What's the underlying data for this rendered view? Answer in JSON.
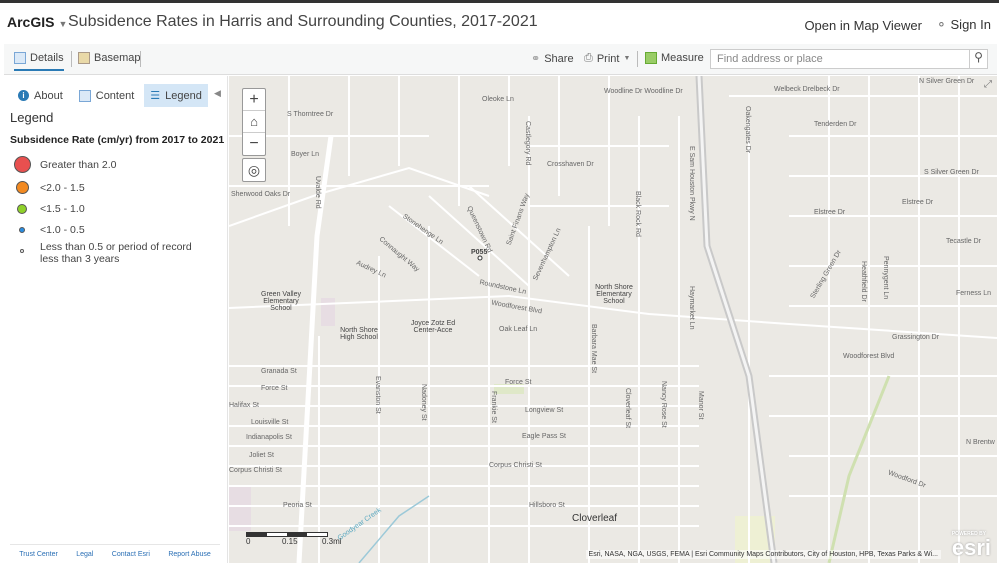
{
  "header": {
    "brand": "ArcGIS",
    "title": "Subsidence Rates in Harris and Surrounding Counties, 2017-2021",
    "open_map_viewer": "Open in Map Viewer",
    "sign_in": "Sign In"
  },
  "toolbar": {
    "details": "Details",
    "basemap": "Basemap",
    "share": "Share",
    "print": "Print",
    "measure": "Measure",
    "search_placeholder": "Find address or place"
  },
  "sidebar": {
    "tabs": [
      "About",
      "Content",
      "Legend"
    ],
    "legend_heading": "Legend",
    "legend_title": "Subsidence Rate (cm/yr) from 2017 to 2021",
    "items": [
      {
        "label": "Greater than 2.0",
        "color": "#e8504f"
      },
      {
        "label": "<2.0 - 1.5",
        "color": "#f28a22"
      },
      {
        "label": "<1.5 - 1.0",
        "color": "#8fd12a"
      },
      {
        "label": "<1.0 - 0.5",
        "color": "#2a8de0"
      },
      {
        "label": "Less than 0.5 or period of record less than 3 years",
        "color": "#ffffff"
      }
    ],
    "footer": [
      "Trust Center",
      "Legal",
      "Contact Esri",
      "Report Abuse"
    ]
  },
  "map": {
    "labels": [
      "S Thorntree Dr",
      "Oleoke Ln",
      "Woodline Dr Woodline Dr",
      "Welbeck Drelbeck Dr",
      "N Silver Green Dr",
      "Boyer Ln",
      "Crosshaven Dr",
      "Oakengates Dr",
      "Tenderden Dr",
      "S Silver Green Dr",
      "Sherwood Oaks Dr",
      "Elstree Dr",
      "Elstree Dr",
      "Tecastle Dr",
      "P055",
      "Stonehenge Ln",
      "Connaught Way",
      "Audrey Ln",
      "Roundstone Ln",
      "North Shore Elementary School",
      "Ferness Ln",
      "Green Valley Elementary School",
      "Woodforest Blvd",
      "North Shore High School",
      "Joyce Zotz Ed Center-Acce",
      "Oak Leaf Ln",
      "Grassington Dr",
      "Woodforest Blvd",
      "Granada St",
      "Force St",
      "Force St",
      "Halifax St",
      "Longview St",
      "Louisville St",
      "Indianapolis St",
      "Eagle Pass St",
      "Joliet St",
      "N Brentw",
      "Corpus Christi St",
      "Corpus Christi St",
      "Peoria St",
      "Hillsboro St",
      "Cloverleaf",
      "Woodford Dr",
      "Goodyear Creek",
      "Uvalde Rd",
      "Evanston St",
      "E Sam Houston Pkwy N",
      "Castlegory Rd",
      "Black Rock Rd",
      "Haymarket Ln",
      "Barbara Mae St",
      "Cloverleaf St",
      "Nancy Rose St",
      "Manor St",
      "Frankie St",
      "Nadoney St",
      "Heathfield Dr",
      "Sterling Green Dr",
      "Pennygent Ln",
      "Sevenhampton Ln",
      "Queenstown Rd",
      "Saint Finans Way"
    ],
    "scale": {
      "zero": "0",
      "mid": "0.15",
      "end": "0.3mi"
    },
    "attribution": "Esri, NASA, NGA, USGS, FEMA | Esri Community Maps Contributors, City of Houston, HPB, Texas Parks & Wi...",
    "powered_by": "POWERED BY",
    "esri": "esri"
  }
}
